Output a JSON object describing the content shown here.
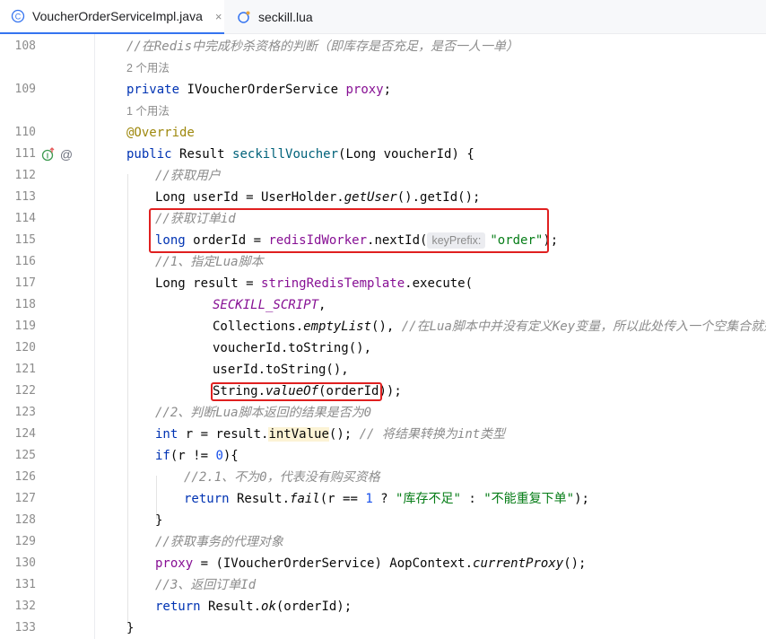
{
  "tabs": [
    {
      "label": "VoucherOrderServiceImpl.java",
      "icon": "java-class-icon",
      "active": true
    },
    {
      "label": "seckill.lua",
      "icon": "lua-file-icon",
      "active": false
    }
  ],
  "close_glyph": "×",
  "usages": {
    "two": "2 个用法",
    "one": "1 个用法"
  },
  "lines": {
    "108": {
      "num": "108",
      "comment": "//在Redis中完成秒杀资格的判断（即库存是否充足，是否一人一单）"
    },
    "109": {
      "num": "109",
      "kw": "private",
      "type": "IVoucherOrderService",
      "field": "proxy",
      "end": ";"
    },
    "110": {
      "num": "110",
      "ann": "@Override"
    },
    "111": {
      "num": "111",
      "kw": "public",
      "t1": "Result",
      "method": "seckillVoucher",
      "params": "(Long voucherId) {"
    },
    "112": {
      "num": "112",
      "comment": "//获取用户"
    },
    "113": {
      "num": "113",
      "a": "Long userId = UserHolder.",
      "call": "getUser",
      "b": "().getId();"
    },
    "114": {
      "num": "114",
      "comment": "//获取订单id"
    },
    "115": {
      "num": "115",
      "kw": "long",
      "a": " orderId = ",
      "field": "redisIdWorker",
      "b": ".nextId(",
      "hint": "keyPrefix:",
      "str": "\"order\"",
      "c": ");"
    },
    "116": {
      "num": "116",
      "comment": "//1、指定Lua脚本"
    },
    "117": {
      "num": "117",
      "a": "Long result = ",
      "field": "stringRedisTemplate",
      "b": ".execute("
    },
    "118": {
      "num": "118",
      "const": "SECKILL_SCRIPT",
      "b": ","
    },
    "119": {
      "num": "119",
      "a": "Collections.",
      "call": "emptyList",
      "b": "(), ",
      "comment": "//在Lua脚本中并没有定义Key变量，所以此处传入一个空集合就好"
    },
    "120": {
      "num": "120",
      "a": "voucherId.toString(),"
    },
    "121": {
      "num": "121",
      "a": "userId.toString(),"
    },
    "122": {
      "num": "122",
      "a": "String.",
      "call": "valueOf",
      "b": "(orderId)",
      "c": ");"
    },
    "123": {
      "num": "123",
      "comment": "//2、判断Lua脚本返回的结果是否为0"
    },
    "124": {
      "num": "124",
      "kw": "int",
      "a": " r = result.",
      "warn": "intValue",
      "b": "(); ",
      "comment": "// 将结果转换为int类型"
    },
    "125": {
      "num": "125",
      "kw": "if",
      "a": "(r != ",
      "n": "0",
      "b": "){"
    },
    "126": {
      "num": "126",
      "comment": "//2.1、不为0，代表没有购买资格"
    },
    "127": {
      "num": "127",
      "kw": "return",
      "a": " Result.",
      "call": "fail",
      "b": "(r == ",
      "n": "1",
      "c": " ? ",
      "s1": "\"库存不足\"",
      "d": " : ",
      "s2": "\"不能重复下单\"",
      "e": ");"
    },
    "128": {
      "num": "128",
      "a": "}"
    },
    "129": {
      "num": "129",
      "comment": "//获取事务的代理对象"
    },
    "130": {
      "num": "130",
      "field": "proxy",
      "a": " = (IVoucherOrderService) AopContext.",
      "call": "currentProxy",
      "b": "();"
    },
    "131": {
      "num": "131",
      "comment": "//3、返回订单Id"
    },
    "132": {
      "num": "132",
      "kw": "return",
      "a": " Result.",
      "call": "ok",
      "b": "(orderId);"
    },
    "133": {
      "num": "133",
      "a": "}"
    }
  },
  "gutter_icons": {
    "implements": "implements-method-icon",
    "override": "override-at-icon",
    "at_glyph": "@"
  },
  "colors": {
    "keyword": "#0033b3",
    "comment": "#8c8c8c",
    "string": "#067d17",
    "number": "#1750eb",
    "annotation": "#9e880d",
    "field": "#871094",
    "method": "#00627a",
    "highlight_box": "#e02020",
    "active_tab": "#3574f0"
  }
}
